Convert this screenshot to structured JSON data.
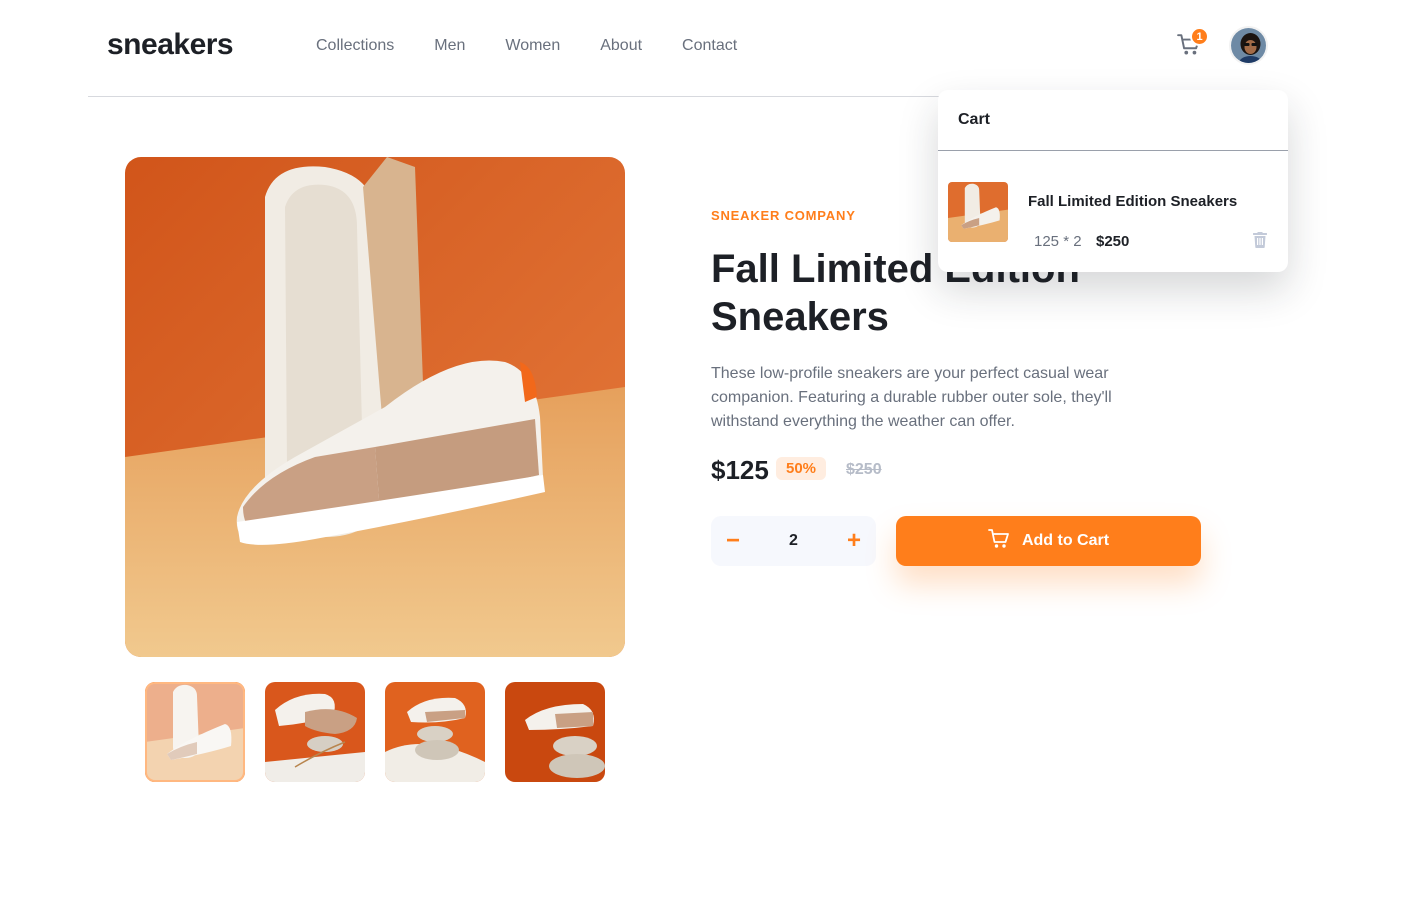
{
  "header": {
    "logo": "sneakers",
    "nav": [
      "Collections",
      "Men",
      "Women",
      "About",
      "Contact"
    ],
    "cart_count": "1",
    "icons": {
      "cart": "cart-icon",
      "avatar": "user-avatar"
    }
  },
  "product": {
    "company": "SNEAKER COMPANY",
    "title": "Fall Limited Edition Sneakers",
    "description": "These low-profile sneakers are your perfect casual wear companion. Featuring a durable rubber outer sole, they'll withstand everything the weather can offer.",
    "price": "$125",
    "discount": "50%",
    "old_price": "$250",
    "quantity": "2",
    "add_to_cart": "Add to Cart",
    "minus": "−",
    "plus": "+"
  },
  "cart": {
    "title": "Cart",
    "item_name": "Fall Limited Edition Sneakers",
    "item_calc": "125 * 2",
    "item_total": "$250"
  },
  "colors": {
    "accent": "#ff7e1b",
    "accent_pale": "#ffede0",
    "dark": "#1d2026",
    "text_muted": "#69707d"
  }
}
